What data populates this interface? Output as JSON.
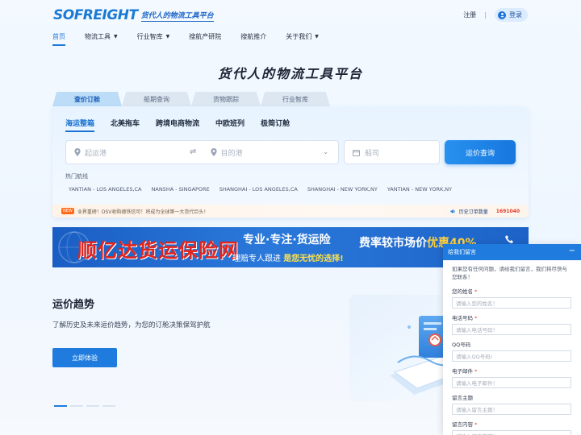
{
  "header": {
    "logo_text": "SOFREIGHT",
    "logo_slogan": "货代人的物流工具平台",
    "register_label": "注册",
    "separator": "|",
    "login_label": "登录"
  },
  "nav": [
    {
      "label": "首页",
      "dropdown": false,
      "active": true
    },
    {
      "label": "物流工具",
      "dropdown": true,
      "active": false
    },
    {
      "label": "行业智库",
      "dropdown": true,
      "active": false
    },
    {
      "label": "搜航产研院",
      "dropdown": false,
      "active": false
    },
    {
      "label": "搜航推介",
      "dropdown": false,
      "active": false
    },
    {
      "label": "关于我们",
      "dropdown": true,
      "active": false
    }
  ],
  "hero": {
    "title": "货代人的物流工具平台",
    "tabs": [
      "查价订舱",
      "船期查询",
      "货物跟踪",
      "行业智库"
    ],
    "active_tab": 0,
    "sub_tabs": [
      "海运整箱",
      "北美拖车",
      "跨境电商物流",
      "中欧班列",
      "极简订舱"
    ],
    "active_sub_tab": 0,
    "origin_placeholder": "起运港",
    "dest_placeholder": "目的港",
    "date_placeholder": "船司",
    "query_button": "运价查询",
    "hot_label": "热门航线",
    "hot_routes": [
      "YANTIAN - LOS ANGELES,CA",
      "NANSHA - SINGAPORE",
      "SHANGHAI - LOS ANGELES,CA",
      "SHANGHAI - NEW YORK,NY",
      "YANTIAN - NEW YORK,NY"
    ]
  },
  "ticker": {
    "badge": "NEW",
    "text": "业界重磅！DSV收购德铁信可！将成为全球第一大货代巨头！",
    "history_label": "历史订单数量",
    "history_count": "1691040"
  },
  "banner": {
    "title": "顺亿达货运保险网",
    "slogan1": "专业·专注·货运险",
    "slogan2_a": "理赔专人跟进",
    "slogan2_b": "是您无忧的选择!",
    "promo_a": "费率较市场价",
    "promo_b": "优惠40%"
  },
  "trend": {
    "title": "运价趋势",
    "description": "了解历史及未来运价趋势，为您的订舱决策保驾护航",
    "button": "立即体验",
    "pager_count": 4,
    "active_page": 0
  },
  "message": {
    "title": "给我们留言",
    "minimize": "−",
    "intro": "如果您有任何问题，请给我们留言，我们将尽快与您联系！",
    "fields": [
      {
        "label": "您的姓名",
        "required": true,
        "placeholder": "请输入您的姓名！"
      },
      {
        "label": "电话号码",
        "required": true,
        "placeholder": "请输入电话号码！"
      },
      {
        "label": "QQ号码",
        "required": false,
        "placeholder": "请输入QQ号码!"
      },
      {
        "label": "电子邮件",
        "required": true,
        "placeholder": "请输入电子邮件！"
      },
      {
        "label": "留言主题",
        "required": false,
        "placeholder": "请输入留言主题！"
      },
      {
        "label": "留言内容",
        "required": true,
        "placeholder": "请输入留言内容！"
      }
    ]
  },
  "colors": {
    "primary": "#1f7cde",
    "brand_red": "#e0251e",
    "accent_orange": "#ff6a1a"
  }
}
